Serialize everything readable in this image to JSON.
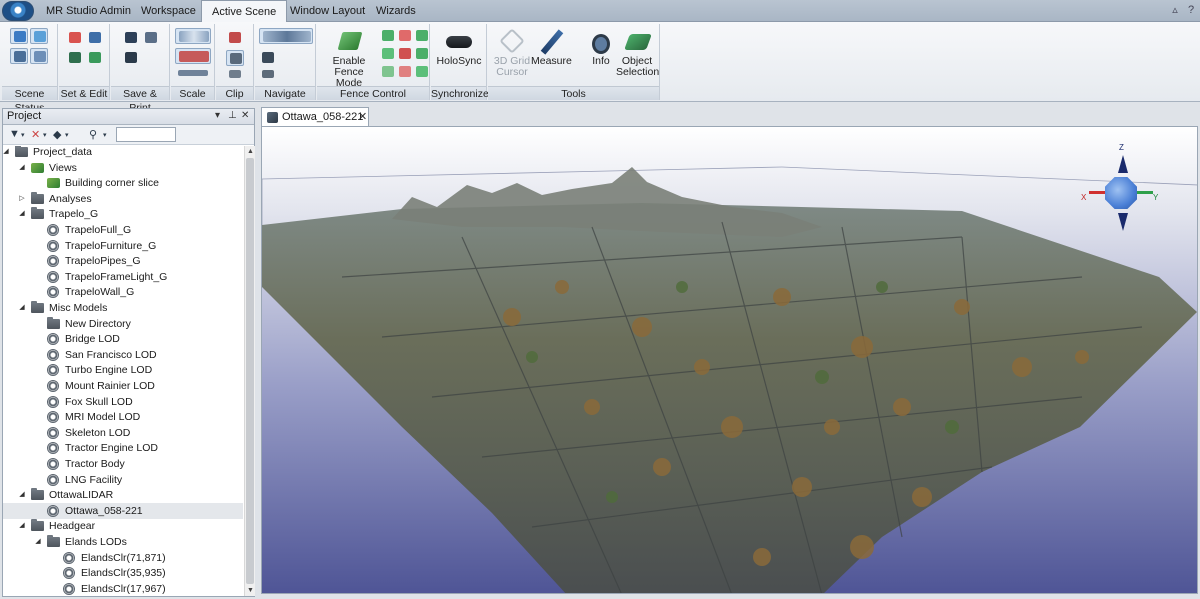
{
  "menu": {
    "tabs": [
      "MR Studio Admin",
      "Workspace",
      "Active Scene",
      "Window Layout",
      "Wizards"
    ],
    "active_tab": "Active Scene"
  },
  "ribbon": {
    "groups": [
      {
        "label": "Scene Status"
      },
      {
        "label": "Set & Edit"
      },
      {
        "label": "Save & Print"
      },
      {
        "label": "Scale"
      },
      {
        "label": "Clip"
      },
      {
        "label": "Navigate"
      },
      {
        "label": "Fence Control"
      },
      {
        "label": "Synchronize"
      },
      {
        "label": "Tools"
      }
    ],
    "buttons": {
      "enable_fence_mode": "Enable\nFence Mode",
      "holosync": "HoloSync",
      "grid_cursor": "3D Grid\nCursor",
      "measure": "Measure",
      "info": "Info",
      "object_selection": "Object\nSelection"
    }
  },
  "panel": {
    "title": "Project",
    "tree": [
      {
        "label": "Project_data",
        "level": 0,
        "icon": "folder-icon",
        "expanded": true
      },
      {
        "label": "Views",
        "level": 1,
        "icon": "views-icon",
        "expanded": true
      },
      {
        "label": "Building corner slice",
        "level": 2,
        "icon": "view-item-icon"
      },
      {
        "label": "Analyses",
        "level": 1,
        "icon": "folder-icon",
        "expanded": false
      },
      {
        "label": "Trapelo_G",
        "level": 1,
        "icon": "folder-icon",
        "expanded": true
      },
      {
        "label": "TrapeloFull_G",
        "level": 2,
        "icon": "node-icon"
      },
      {
        "label": "TrapeloFurniture_G",
        "level": 2,
        "icon": "node-icon"
      },
      {
        "label": "TrapeloPipes_G",
        "level": 2,
        "icon": "node-icon"
      },
      {
        "label": "TrapeloFrameLight_G",
        "level": 2,
        "icon": "node-icon"
      },
      {
        "label": "TrapeloWall_G",
        "level": 2,
        "icon": "node-icon"
      },
      {
        "label": "Misc Models",
        "level": 1,
        "icon": "folder-icon",
        "expanded": true
      },
      {
        "label": "New Directory",
        "level": 2,
        "icon": "folder-icon"
      },
      {
        "label": "Bridge LOD",
        "level": 2,
        "icon": "node-icon"
      },
      {
        "label": "San Francisco LOD",
        "level": 2,
        "icon": "node-icon"
      },
      {
        "label": "Turbo Engine LOD",
        "level": 2,
        "icon": "node-icon"
      },
      {
        "label": "Mount Rainier LOD",
        "level": 2,
        "icon": "node-icon"
      },
      {
        "label": "Fox Skull LOD",
        "level": 2,
        "icon": "node-icon"
      },
      {
        "label": "MRI Model LOD",
        "level": 2,
        "icon": "node-icon"
      },
      {
        "label": "Skeleton LOD",
        "level": 2,
        "icon": "node-icon"
      },
      {
        "label": "Tractor Engine LOD",
        "level": 2,
        "icon": "node-icon"
      },
      {
        "label": "Tractor Body",
        "level": 2,
        "icon": "node-icon"
      },
      {
        "label": "LNG Facility",
        "level": 2,
        "icon": "node-icon"
      },
      {
        "label": "OttawaLIDAR",
        "level": 1,
        "icon": "folder-icon",
        "expanded": true
      },
      {
        "label": "Ottawa_058-221",
        "level": 2,
        "icon": "pointcloud-icon",
        "selected": true
      },
      {
        "label": "Headgear",
        "level": 1,
        "icon": "folder-icon",
        "expanded": true
      },
      {
        "label": "Elands LODs",
        "level": 2,
        "icon": "folder-icon",
        "expanded": true
      },
      {
        "label": "ElandsClr(71,871)",
        "level": 3,
        "icon": "node-icon"
      },
      {
        "label": "ElandsClr(35,935)",
        "level": 3,
        "icon": "node-icon"
      },
      {
        "label": "ElandsClr(17,967)",
        "level": 3,
        "icon": "node-icon"
      }
    ]
  },
  "document": {
    "tab_label": "Ottawa_058-221"
  },
  "axes_gizmo": {
    "z": "Z",
    "x": "X",
    "y": "Y"
  },
  "colors": {
    "accent": "#3a83c7",
    "gizmo": "#4a7fd6",
    "sky_top": "#ffffff",
    "ground": "#4f5596"
  }
}
